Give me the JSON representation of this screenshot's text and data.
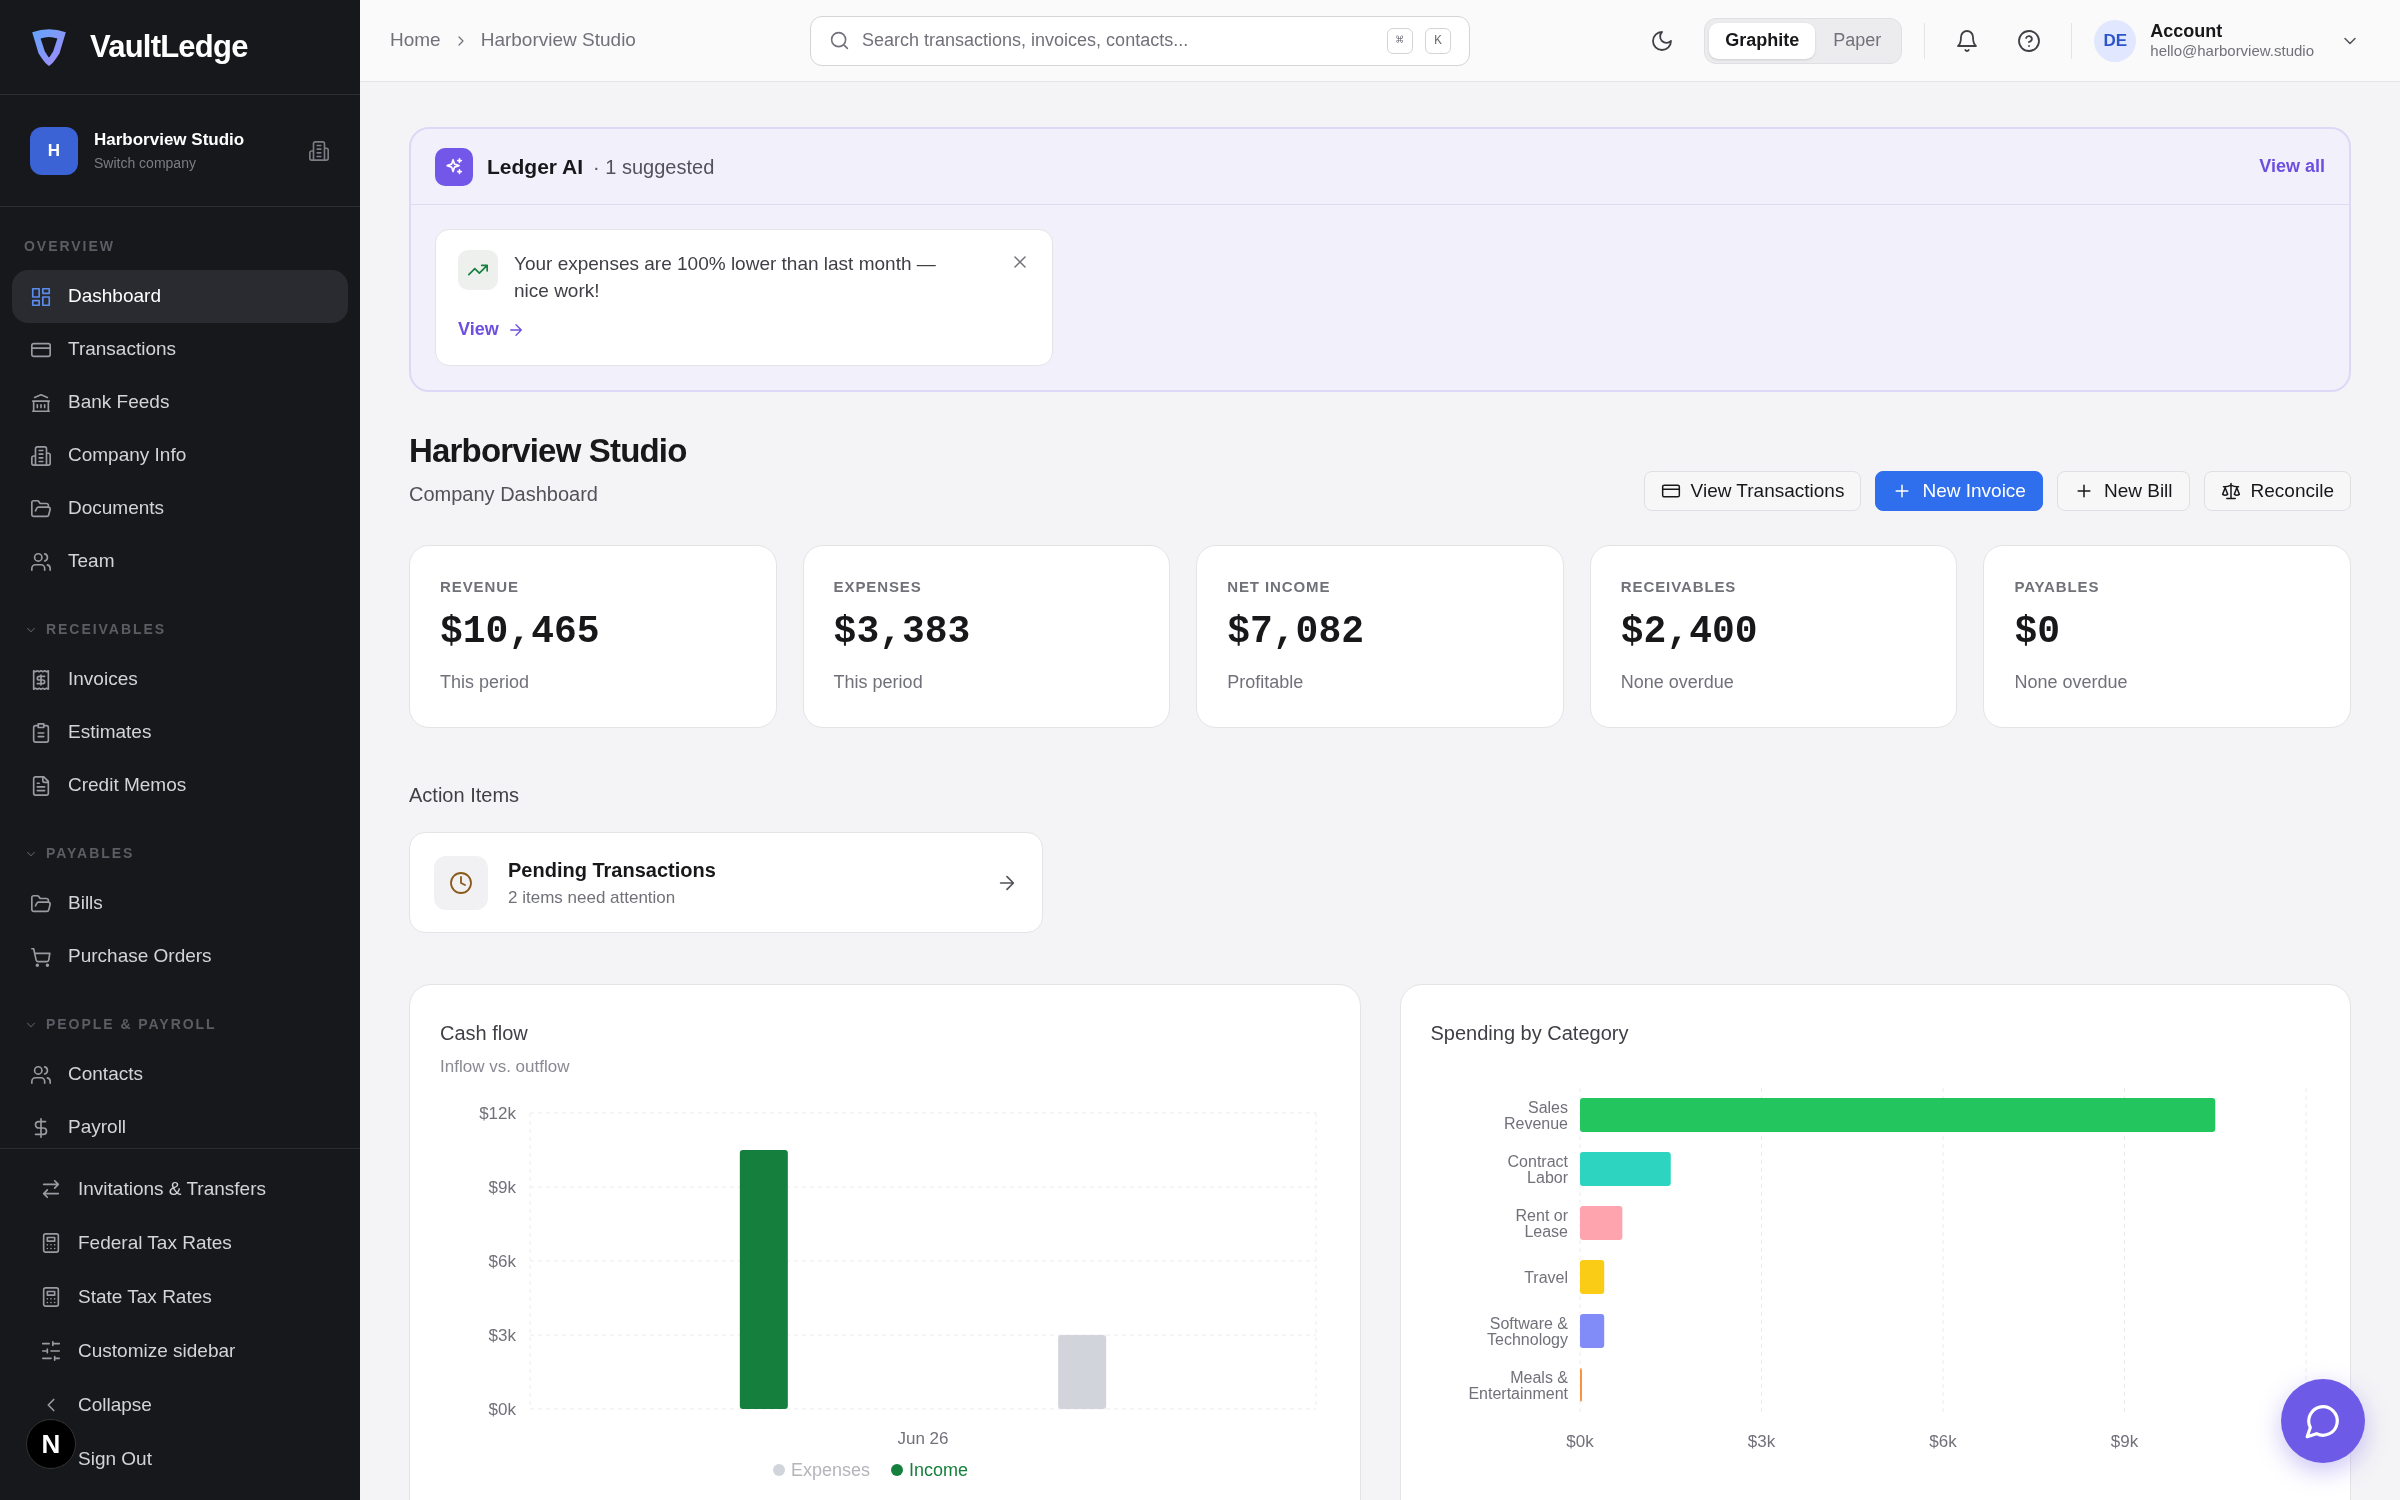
{
  "sidebar": {
    "brand": "VaultLedge",
    "company": {
      "initial": "H",
      "name": "Harborview Studio",
      "subtitle": "Switch company"
    },
    "sections": [
      {
        "title": "OVERVIEW",
        "collapsible": false,
        "expanded": true,
        "items": [
          {
            "label": "Dashboard",
            "selected": true
          },
          {
            "label": "Transactions",
            "selected": false
          },
          {
            "label": "Bank Feeds",
            "selected": false
          },
          {
            "label": "Company Info",
            "selected": false
          },
          {
            "label": "Documents",
            "selected": false
          },
          {
            "label": "Team",
            "selected": false
          }
        ]
      },
      {
        "title": "RECEIVABLES",
        "collapsible": true,
        "expanded": true,
        "items": [
          {
            "label": "Invoices",
            "selected": false
          },
          {
            "label": "Estimates",
            "selected": false
          },
          {
            "label": "Credit Memos",
            "selected": false
          }
        ]
      },
      {
        "title": "PAYABLES",
        "collapsible": true,
        "expanded": true,
        "items": [
          {
            "label": "Bills",
            "selected": false
          },
          {
            "label": "Purchase Orders",
            "selected": false
          }
        ]
      },
      {
        "title": "PEOPLE & PAYROLL",
        "collapsible": true,
        "expanded": true,
        "items": [
          {
            "label": "Contacts",
            "selected": false
          },
          {
            "label": "Payroll",
            "selected": false
          }
        ]
      }
    ],
    "footer_items": [
      "Invitations & Transfers",
      "Federal Tax Rates",
      "State Tax Rates",
      "Customize sidebar",
      "Collapse",
      "Sign Out"
    ],
    "dev_badge": "N"
  },
  "top_bar": {
    "breadcrumb": [
      "Home",
      "Harborview Studio"
    ],
    "search": {
      "placeholder": "Search transactions, invoices, contacts...",
      "keys": [
        "⌘",
        "K"
      ]
    },
    "themes": [
      {
        "label": "Graphite",
        "selected": true
      },
      {
        "label": "Paper",
        "selected": false
      }
    ],
    "account": {
      "initials": "DE",
      "name": "Account",
      "email": "hello@harborview.studio"
    }
  },
  "ai_panel": {
    "title": "Ledger AI",
    "meta": "· 1 suggested",
    "link": "View all",
    "suggestion": {
      "text": "Your expenses are 100% lower than last month — nice work!",
      "action": "View"
    }
  },
  "header": {
    "title": "Harborview Studio",
    "subtitle": "Company Dashboard",
    "actions": [
      {
        "label": "View Transactions",
        "kind": "secondary"
      },
      {
        "label": "New Invoice",
        "kind": "primary"
      },
      {
        "label": "New Bill",
        "kind": "secondary"
      },
      {
        "label": "Reconcile",
        "kind": "secondary"
      }
    ]
  },
  "stats": [
    {
      "label": "REVENUE",
      "value": "$10,465",
      "note": "This period"
    },
    {
      "label": "EXPENSES",
      "value": "$3,383",
      "note": "This period"
    },
    {
      "label": "NET INCOME",
      "value": "$7,082",
      "note": "Profitable"
    },
    {
      "label": "RECEIVABLES",
      "value": "$2,400",
      "note": "None overdue"
    },
    {
      "label": "PAYABLES",
      "value": "$0",
      "note": "None overdue"
    }
  ],
  "action_items": {
    "title": "Action Items",
    "items": [
      {
        "title": "Pending Transactions",
        "subtitle": "2 items need attention"
      }
    ]
  },
  "cash_flow": {
    "title": "Cash flow",
    "subtitle": "Inflow vs. outflow",
    "chart_data": {
      "type": "bar",
      "categories": [
        "Jun 26"
      ],
      "series": [
        {
          "name": "Expenses",
          "color": "#d1d5db",
          "values": [
            3000
          ]
        },
        {
          "name": "Income",
          "color": "#15803d",
          "values": [
            10500
          ]
        }
      ],
      "grid": true,
      "legend": "bottom",
      "ylim": [
        0,
        12000
      ],
      "yticks": [
        {
          "value": 0,
          "label": "$0k"
        },
        {
          "value": 3000,
          "label": "$3k"
        },
        {
          "value": 6000,
          "label": "$6k"
        },
        {
          "value": 9000,
          "label": "$9k"
        },
        {
          "value": 12000,
          "label": "$12k"
        }
      ]
    }
  },
  "spending": {
    "title": "Spending by Category",
    "chart_data": {
      "type": "bar",
      "orientation": "horizontal",
      "categories": [
        "Sales Revenue",
        "Contract Labor",
        "Rent or Lease",
        "Travel",
        "Software & Technology",
        "Meals & Entertainment"
      ],
      "values": [
        10500,
        1500,
        700,
        400,
        400,
        0
      ],
      "grid": true,
      "colors": [
        "#22c55e",
        "#2dd4bf",
        "#fda4af",
        "#facc15",
        "#818cf8",
        "#fb923c"
      ],
      "xlim": [
        0,
        12000
      ],
      "xticks": [
        {
          "value": 0,
          "label": "$0k"
        },
        {
          "value": 3000,
          "label": "$3k"
        },
        {
          "value": 6000,
          "label": "$6k"
        },
        {
          "value": 9000,
          "label": "$9k"
        }
      ]
    }
  }
}
